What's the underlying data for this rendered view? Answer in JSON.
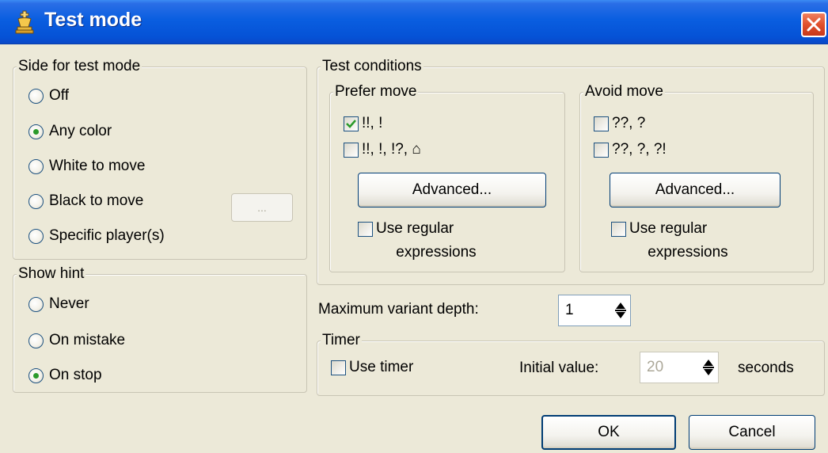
{
  "window": {
    "title": "Test mode",
    "icons": {
      "app": "chess-king-icon",
      "close": "close-icon"
    }
  },
  "side_group": {
    "legend": "Side for test mode",
    "options": [
      {
        "label": "Off",
        "selected": false
      },
      {
        "label": "Any color",
        "selected": true
      },
      {
        "label": "White to move",
        "selected": false
      },
      {
        "label": "Black to move",
        "selected": false
      },
      {
        "label": "Specific player(s)",
        "selected": false
      }
    ],
    "browse_button": {
      "label": "...",
      "enabled": false
    }
  },
  "hint_group": {
    "legend": "Show hint",
    "options": [
      {
        "label": "Never",
        "selected": false
      },
      {
        "label": "On mistake",
        "selected": false
      },
      {
        "label": "On stop",
        "selected": true
      }
    ]
  },
  "test_conditions": {
    "legend": "Test conditions",
    "prefer": {
      "legend": "Prefer move",
      "check1": {
        "label": "!!, !",
        "checked": true
      },
      "check2": {
        "label": "!!, !, !?, ⌂",
        "checked": false
      },
      "advanced_label": "Advanced...",
      "regex": {
        "line1": "Use regular",
        "line2": "expressions",
        "checked": false
      }
    },
    "avoid": {
      "legend": "Avoid move",
      "check1": {
        "label": "??, ?",
        "checked": false
      },
      "check2": {
        "label": "??, ?, ?!",
        "checked": false
      },
      "advanced_label": "Advanced...",
      "regex": {
        "line1": "Use regular",
        "line2": "expressions",
        "checked": false
      }
    }
  },
  "depth": {
    "label": "Maximum variant depth:",
    "value": "1"
  },
  "timer": {
    "legend": "Timer",
    "use_label": "Use timer",
    "use_checked": false,
    "initial_label": "Initial value:",
    "initial_value": "20",
    "unit_label": "seconds"
  },
  "buttons": {
    "ok": "OK",
    "cancel": "Cancel"
  },
  "colors": {
    "titlebar": "#0a5ee0",
    "dialog_bg": "#ece9d8",
    "check_mark": "#2a9a2a",
    "close": "#e0502c"
  }
}
